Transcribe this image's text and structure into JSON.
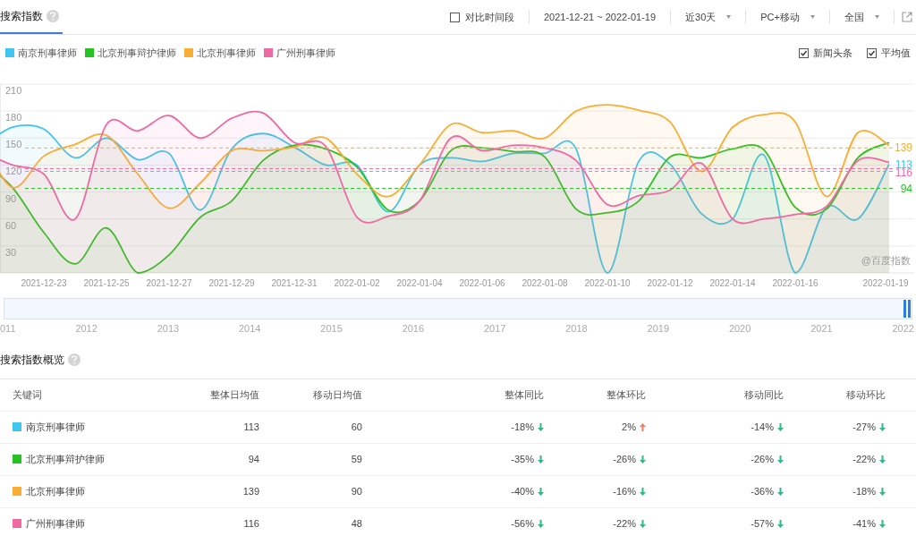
{
  "header": {
    "title": "搜索指数",
    "compare_period": {
      "label": "对比时间段",
      "checked": false
    },
    "date_range": "2021-12-21 ~ 2022-01-19",
    "dropdowns": [
      "近30天",
      "PC+移动",
      "全国"
    ]
  },
  "legend_options": [
    {
      "label": "新闻头条",
      "checked": true
    },
    {
      "label": "平均值",
      "checked": true
    }
  ],
  "chart": {
    "credit": "@百度指数",
    "chart_data": {
      "type": "area",
      "categories": [
        null,
        null,
        "2021-12-23",
        null,
        "2021-12-25",
        null,
        "2021-12-27",
        null,
        "2021-12-29",
        null,
        "2021-12-31",
        null,
        "2022-01-02",
        null,
        "2022-01-04",
        null,
        "2022-01-06",
        null,
        "2022-01-08",
        null,
        "2022-01-10",
        null,
        "2022-01-12",
        null,
        "2022-01-14",
        null,
        "2022-01-16",
        null,
        null,
        "2022-01-19"
      ],
      "series": [
        {
          "name": "南京刑事律师",
          "color": "#3ec6f0",
          "values": [
            140,
            162,
            160,
            128,
            150,
            126,
            133,
            70,
            138,
            155,
            140,
            120,
            120,
            68,
            120,
            128,
            124,
            133,
            133,
            138,
            0,
            124,
            121,
            66,
            60,
            131,
            0,
            73,
            60,
            121
          ]
        },
        {
          "name": "北京刑事辩护律师",
          "color": "#26c224",
          "values": [
            125,
            95,
            45,
            10,
            50,
            0,
            20,
            62,
            80,
            125,
            142,
            138,
            118,
            70,
            80,
            136,
            139,
            135,
            129,
            71,
            67,
            80,
            129,
            128,
            138,
            137,
            73,
            71,
            128,
            145
          ]
        },
        {
          "name": "北京刑事律师",
          "color": "#f8ae34",
          "values": [
            150,
            95,
            130,
            143,
            153,
            110,
            72,
            100,
            136,
            136,
            140,
            150,
            110,
            85,
            120,
            165,
            156,
            158,
            150,
            180,
            187,
            181,
            168,
            113,
            162,
            176,
            168,
            85,
            156,
            142
          ]
        },
        {
          "name": "广州刑事律师",
          "color": "#ee6aa5",
          "values": [
            135,
            120,
            110,
            60,
            165,
            158,
            175,
            150,
            172,
            178,
            145,
            141,
            62,
            63,
            80,
            150,
            136,
            142,
            139,
            125,
            76,
            86,
            92,
            122,
            60,
            60,
            65,
            74,
            125,
            123
          ]
        }
      ],
      "ylim": [
        0,
        210
      ],
      "yticks": [
        30,
        60,
        90,
        120,
        150,
        180,
        210
      ],
      "grid": true,
      "ref_lines": [
        {
          "axis": "y",
          "value": 113,
          "label": "113",
          "color": "#3ec6f0"
        },
        {
          "axis": "y",
          "value": 94,
          "label": "94",
          "color": "#26c224"
        },
        {
          "axis": "y",
          "value": 139,
          "label": "139",
          "color": "#f8ae34"
        },
        {
          "axis": "y",
          "value": 116,
          "label": "116",
          "color": "#ee6aa5"
        }
      ]
    }
  },
  "timeline": {
    "labels": [
      "011",
      "2012",
      "2013",
      "2014",
      "2015",
      "2016",
      "2017",
      "2018",
      "2019",
      "2020",
      "2021",
      "2022"
    ]
  },
  "overview": {
    "title": "搜索指数概览",
    "columns": [
      "关键词",
      "整体日均值",
      "移动日均值",
      "整体同比",
      "整体环比",
      "移动同比",
      "移动环比"
    ],
    "rows": [
      {
        "color": "#3ec6f0",
        "cells": [
          {
            "text": "南京刑事律师"
          },
          {
            "text": "113"
          },
          {
            "text": "60"
          },
          {
            "text": "-18%",
            "rising": false
          },
          {
            "text": "2%",
            "rising": true
          },
          {
            "text": "-14%",
            "rising": false
          },
          {
            "text": "-27%",
            "rising": false
          }
        ]
      },
      {
        "color": "#26c224",
        "cells": [
          {
            "text": "北京刑事辩护律师"
          },
          {
            "text": "94"
          },
          {
            "text": "59"
          },
          {
            "text": "-35%",
            "rising": false
          },
          {
            "text": "-26%",
            "rising": false
          },
          {
            "text": "-26%",
            "rising": false
          },
          {
            "text": "-22%",
            "rising": false
          }
        ]
      },
      {
        "color": "#f8ae34",
        "cells": [
          {
            "text": "北京刑事律师"
          },
          {
            "text": "139"
          },
          {
            "text": "90"
          },
          {
            "text": "-40%",
            "rising": false
          },
          {
            "text": "-16%",
            "rising": false
          },
          {
            "text": "-36%",
            "rising": false
          },
          {
            "text": "-18%",
            "rising": false
          }
        ]
      },
      {
        "color": "#ee6aa5",
        "cells": [
          {
            "text": "广州刑事律师"
          },
          {
            "text": "116"
          },
          {
            "text": "48"
          },
          {
            "text": "-56%",
            "rising": false
          },
          {
            "text": "-22%",
            "rising": false
          },
          {
            "text": "-57%",
            "rising": false
          },
          {
            "text": "-41%",
            "rising": false
          }
        ]
      }
    ]
  }
}
